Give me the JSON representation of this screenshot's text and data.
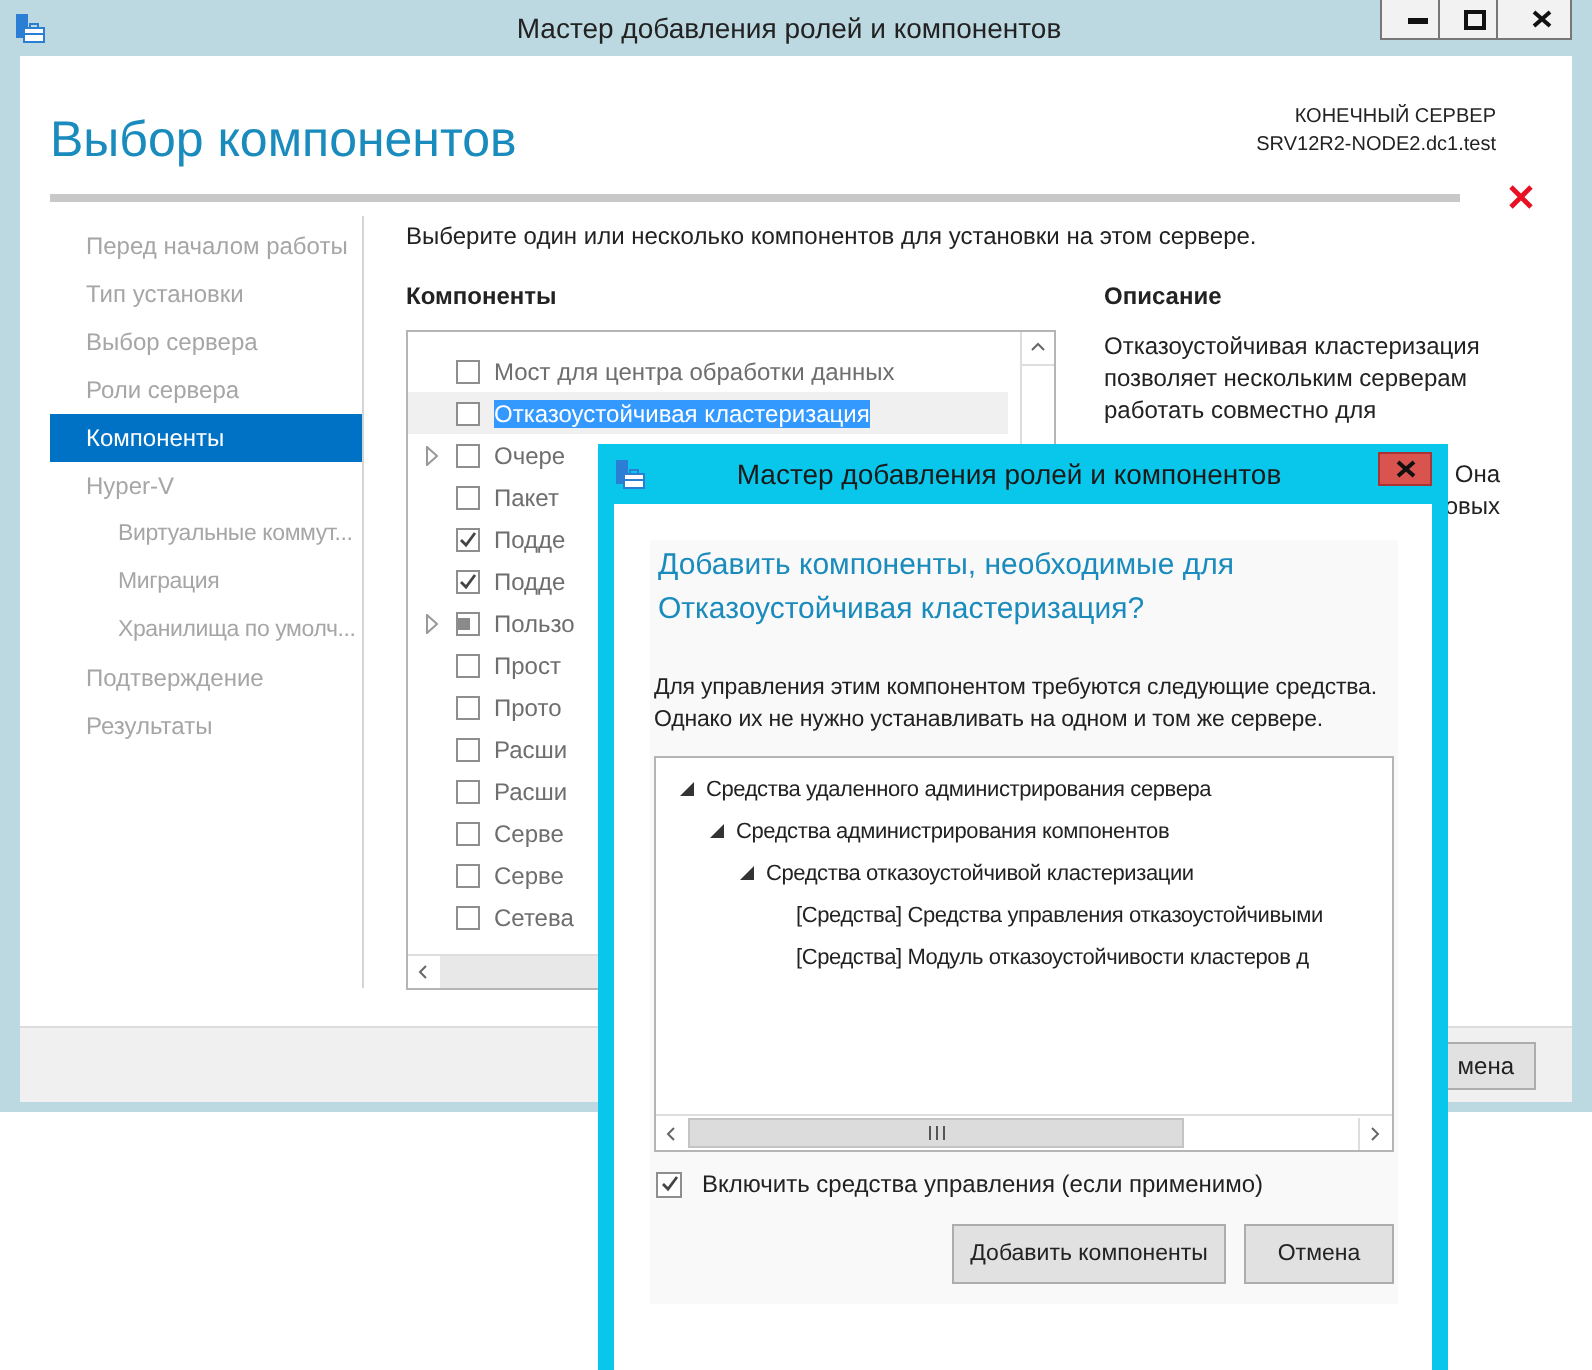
{
  "window": {
    "title": "Мастер добавления ролей и компонентов"
  },
  "page_title": "Выбор компонентов",
  "server": {
    "label": "КОНЕЧНЫЙ СЕРВЕР",
    "name": "SRV12R2-NODE2.dc1.test"
  },
  "sidebar": {
    "items": [
      {
        "label": "Перед началом работы",
        "selected": false
      },
      {
        "label": "Тип установки",
        "selected": false
      },
      {
        "label": "Выбор сервера",
        "selected": false
      },
      {
        "label": "Роли сервера",
        "selected": false
      },
      {
        "label": "Компоненты",
        "selected": true
      },
      {
        "label": "Hyper-V",
        "selected": false,
        "children": [
          {
            "label": "Виртуальные коммут...",
            "selected": false
          },
          {
            "label": "Миграция",
            "selected": false
          },
          {
            "label": "Хранилища по умолч...",
            "selected": false
          }
        ]
      },
      {
        "label": "Подтверждение",
        "selected": false
      },
      {
        "label": "Результаты",
        "selected": false
      }
    ]
  },
  "instruction": "Выберите один или несколько компонентов для установки на этом сервере.",
  "components": {
    "title": "Компоненты",
    "items": [
      {
        "label": "Мост для центра обработки данных",
        "checked": false,
        "partial": false,
        "expandable": false,
        "selected": false
      },
      {
        "label": "Отказоустойчивая кластеризация",
        "checked": false,
        "partial": false,
        "expandable": false,
        "selected": true
      },
      {
        "label": "Очере",
        "checked": false,
        "partial": false,
        "expandable": true,
        "selected": false
      },
      {
        "label": "Пакет",
        "checked": false,
        "partial": false,
        "expandable": false,
        "selected": false
      },
      {
        "label": "Подде",
        "checked": true,
        "partial": false,
        "expandable": false,
        "selected": false
      },
      {
        "label": "Подде",
        "checked": true,
        "partial": false,
        "expandable": false,
        "selected": false
      },
      {
        "label": "Пользо",
        "checked": false,
        "partial": true,
        "expandable": true,
        "selected": false
      },
      {
        "label": "Прост",
        "checked": false,
        "partial": false,
        "expandable": false,
        "selected": false
      },
      {
        "label": "Прото",
        "checked": false,
        "partial": false,
        "expandable": false,
        "selected": false
      },
      {
        "label": "Расши",
        "checked": false,
        "partial": false,
        "expandable": false,
        "selected": false
      },
      {
        "label": "Расши",
        "checked": false,
        "partial": false,
        "expandable": false,
        "selected": false
      },
      {
        "label": "Серве",
        "checked": false,
        "partial": false,
        "expandable": false,
        "selected": false
      },
      {
        "label": "Серве",
        "checked": false,
        "partial": false,
        "expandable": false,
        "selected": false
      },
      {
        "label": "Сетева",
        "checked": false,
        "partial": false,
        "expandable": false,
        "selected": false
      }
    ]
  },
  "description": {
    "title": "Описание",
    "lines": [
      "Отказоустойчивая кластеризация",
      "позволяет нескольким серверам",
      "работать совместно для"
    ],
    "fragments": [
      "Она",
      "овых"
    ]
  },
  "footer": {
    "button": "мена"
  },
  "dialog": {
    "title": "Мастер добавления ролей и компонентов",
    "heading": "Добавить компоненты, необходимые для Отказоустойчивая кластеризация?",
    "text": "Для управления этим компонентом требуются следующие средства. Однако их не нужно устанавливать на одном и том же сервере.",
    "tree": [
      {
        "label": "Средства удаленного администрирования сервера",
        "expanded": true,
        "children": [
          {
            "label": "Средства администрирования компонентов",
            "expanded": true,
            "children": [
              {
                "label": "Средства отказоустойчивой кластеризации",
                "expanded": true,
                "children": [
                  {
                    "label": "[Средства] Средства управления отказоустойчивыми"
                  },
                  {
                    "label": "[Средства] Модуль отказоустойчивости кластеров д"
                  }
                ]
              }
            ]
          }
        ]
      }
    ],
    "include_tools": {
      "label": "Включить средства управления (если применимо)",
      "checked": true
    },
    "buttons": [
      "Добавить компоненты",
      "Отмена"
    ]
  }
}
